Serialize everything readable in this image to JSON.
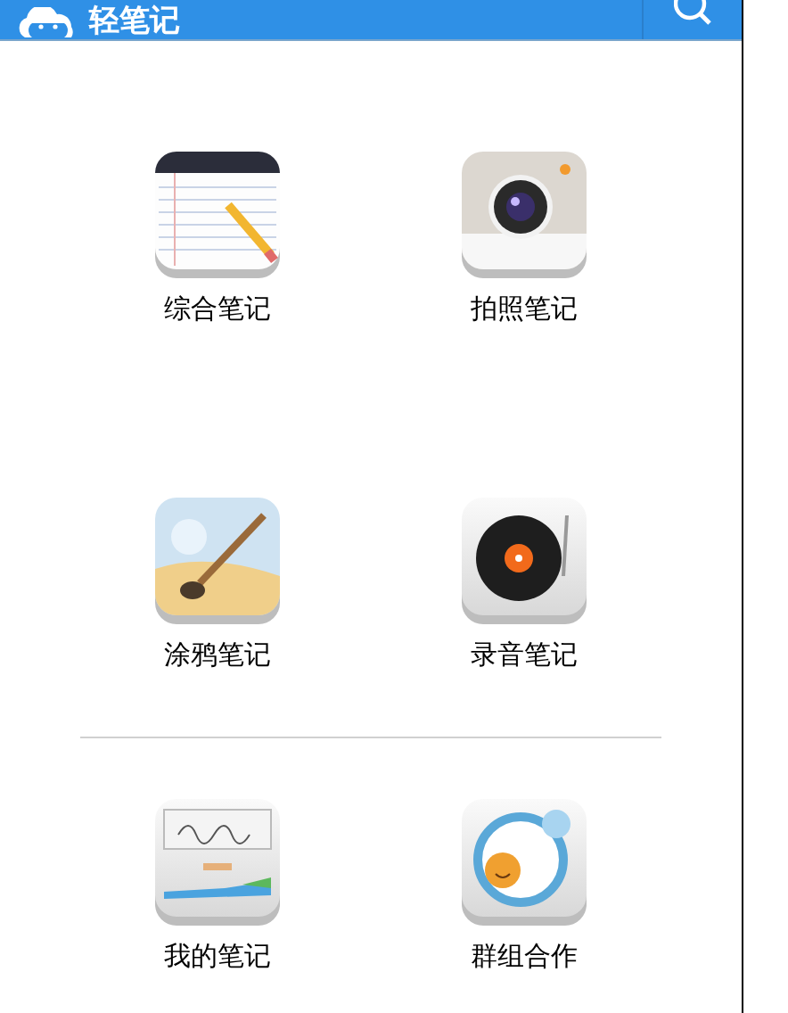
{
  "header": {
    "title": "轻笔记"
  },
  "sections": [
    {
      "items": [
        {
          "kind": "notebook",
          "label": "综合笔记"
        },
        {
          "kind": "camera",
          "label": "拍照笔记"
        },
        {
          "kind": "paint",
          "label": "涂鸦笔记"
        },
        {
          "kind": "record",
          "label": "录音笔记"
        }
      ]
    },
    {
      "items": [
        {
          "kind": "drawer",
          "label": "我的笔记"
        },
        {
          "kind": "group",
          "label": "群组合作"
        }
      ]
    }
  ]
}
